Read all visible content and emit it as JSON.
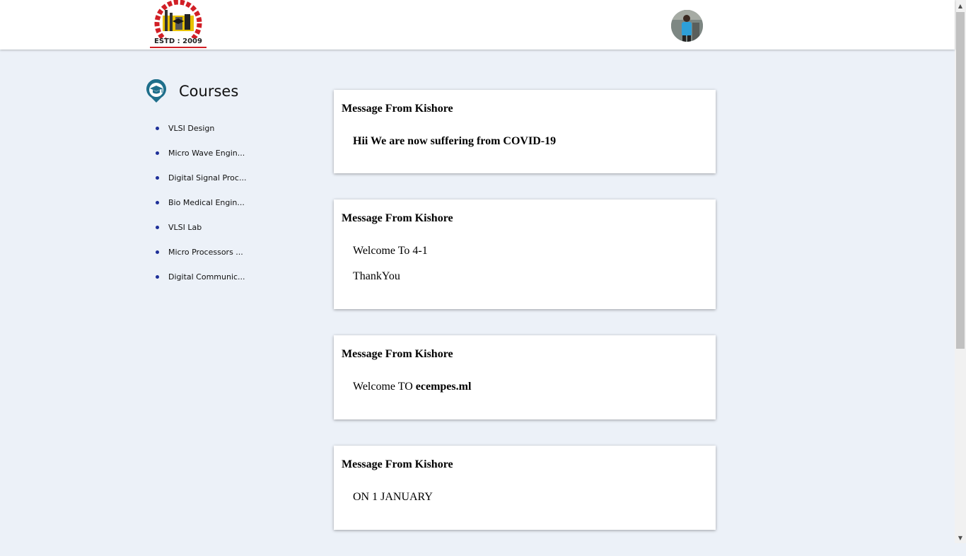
{
  "header": {
    "logo_text": "MALINENI PERUMALLU EDUCATIONAL SOCIETY",
    "logo_estd": "ESTD : 2009"
  },
  "sidebar": {
    "title": "Courses",
    "items": [
      {
        "label": "VLSI Design"
      },
      {
        "label": "Micro Wave Engin..."
      },
      {
        "label": "Digital Signal Proc..."
      },
      {
        "label": "Bio Medical Engin..."
      },
      {
        "label": "VLSI Lab"
      },
      {
        "label": "Micro Processors ..."
      },
      {
        "label": "Digital Communic..."
      }
    ]
  },
  "messages": [
    {
      "title": "Message From Kishore",
      "line1": "Hii We are now suffering from COVID-19"
    },
    {
      "title": "Message From Kishore",
      "line1": "Welcome To 4-1",
      "line2": "ThankYou"
    },
    {
      "title": "Message From Kishore",
      "line1_prefix": "Welcome TO ",
      "line1_bold": "ecempes.ml"
    },
    {
      "title": "Message From Kishore",
      "line1": "ON 1 JANUARY"
    }
  ],
  "colors": {
    "page_bg": "#ecf1f8",
    "bullet": "#1d2f98",
    "icon_teal": "#1f6f8b"
  },
  "icons": {
    "courses": "graduation-cap-pin-icon",
    "scroll_up": "triangle-up",
    "scroll_down": "triangle-down"
  }
}
